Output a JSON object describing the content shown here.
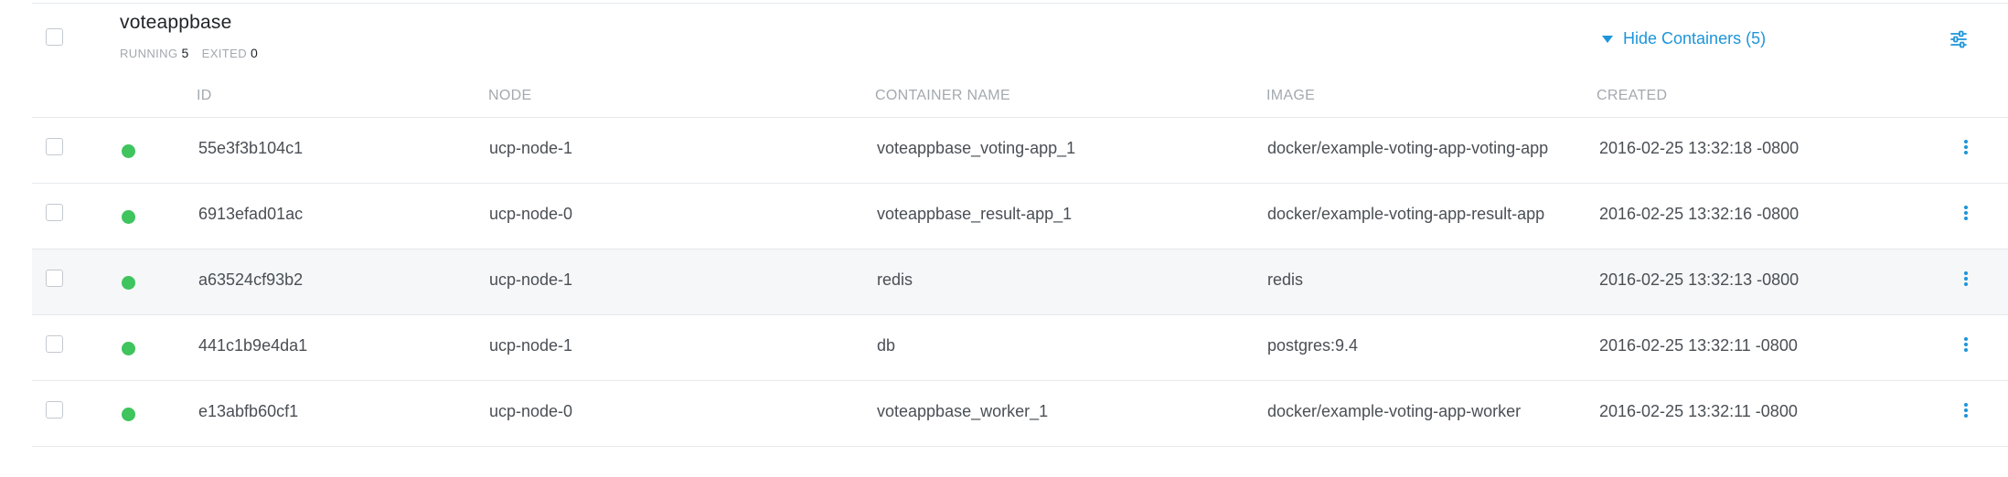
{
  "group": {
    "name": "voteappbase",
    "running_label": "RUNNING",
    "running_count": "5",
    "exited_label": "EXITED",
    "exited_count": "0",
    "toggle_label": "Hide Containers (5)",
    "accent_color": "#1d95d9"
  },
  "columns": {
    "id": "ID",
    "node": "NODE",
    "container_name": "CONTAINER NAME",
    "image": "IMAGE",
    "created": "CREATED"
  },
  "containers": [
    {
      "id": "55e3f3b104c1",
      "node": "ucp-node-1",
      "name": "voteappbase_voting-app_1",
      "image": "docker/example-voting-app-voting-app",
      "created": "2016-02-25 13:32:18 -0800",
      "status": "running"
    },
    {
      "id": "6913efad01ac",
      "node": "ucp-node-0",
      "name": "voteappbase_result-app_1",
      "image": "docker/example-voting-app-result-app",
      "created": "2016-02-25 13:32:16 -0800",
      "status": "running"
    },
    {
      "id": "a63524cf93b2",
      "node": "ucp-node-1",
      "name": "redis",
      "image": "redis",
      "created": "2016-02-25 13:32:13 -0800",
      "status": "running"
    },
    {
      "id": "441c1b9e4da1",
      "node": "ucp-node-1",
      "name": "db",
      "image": "postgres:9.4",
      "created": "2016-02-25 13:32:11 -0800",
      "status": "running"
    },
    {
      "id": "e13abfb60cf1",
      "node": "ucp-node-0",
      "name": "voteappbase_worker_1",
      "image": "docker/example-voting-app-worker",
      "created": "2016-02-25 13:32:11 -0800",
      "status": "running"
    }
  ],
  "status_colors": {
    "running": "#3fc45e"
  },
  "icons": {
    "settings": "sliders-icon",
    "row_menu": "kebab-menu-icon",
    "toggle": "caret-down-icon"
  }
}
